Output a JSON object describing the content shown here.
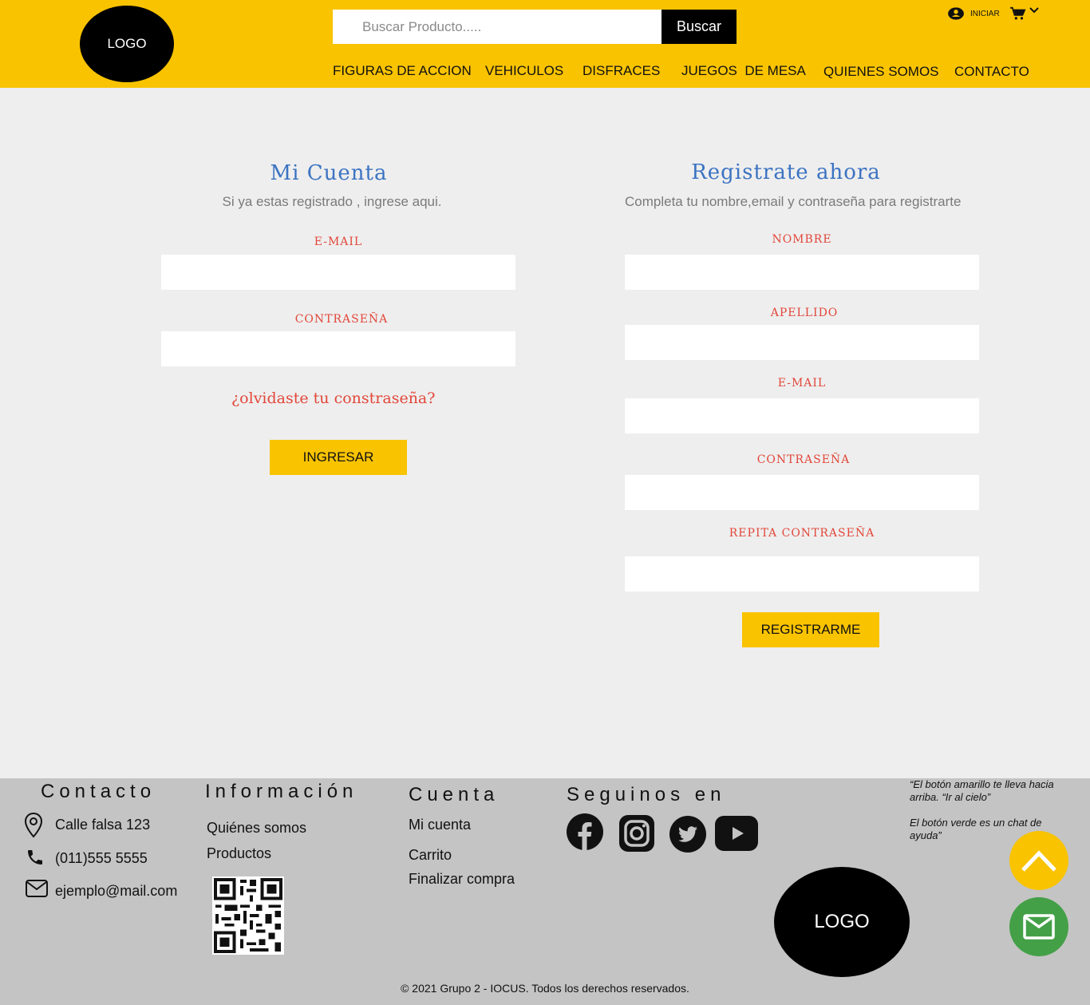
{
  "header": {
    "logo_text": "LOGO",
    "search": {
      "placeholder": "Buscar Producto.....",
      "button_label": "Buscar"
    },
    "login_label": "INICIAR",
    "nav": [
      {
        "label": "FIGURAS DE ACCION"
      },
      {
        "label": "VEHICULOS"
      },
      {
        "label": "DISFRACES"
      },
      {
        "label": "JUEGOS  DE MESA"
      },
      {
        "label": "QUIENES SOMOS"
      },
      {
        "label": "CONTACTO"
      }
    ]
  },
  "login": {
    "title": "Mi Cuenta",
    "subtitle": "Si ya estas registrado , ingrese aqui.",
    "email_label": "E-MAIL",
    "password_label": "CONTRASEÑA",
    "forgot_label": "¿olvidaste tu constraseña?",
    "submit_label": "INGRESAR"
  },
  "register": {
    "title": "Registrate ahora",
    "subtitle": "Completa tu nombre,email y contraseña para registrarte",
    "name_label": "NOMBRE",
    "lastname_label": "APELLIDO",
    "email_label": "E-MAIL",
    "password_label": "CONTRASEÑA",
    "repeat_password_label": "REPITA CONTRASEÑA",
    "submit_label": "REGISTRARME"
  },
  "footer": {
    "contact": {
      "heading": "Contacto",
      "address": "Calle falsa 123",
      "phone": "(011)555 5555",
      "email": "ejemplo@mail.com"
    },
    "info": {
      "heading": "Información",
      "links": [
        "Quiénes somos",
        "Productos"
      ]
    },
    "account": {
      "heading": "Cuenta",
      "links": [
        "Mi cuenta",
        "Carrito",
        "Finalizar compra"
      ]
    },
    "social": {
      "heading": "Seguinos en",
      "icons": [
        "facebook-icon",
        "instagram-icon",
        "twitter-icon",
        "youtube-icon"
      ]
    },
    "logo_text": "LOGO",
    "note_line1": "“El botón amarillo te lleva hacia arriba. “Ir al cielo”",
    "note_line2": "El botón verde es un chat de ayuda”",
    "copyright": "© 2021 Grupo 2 - IOCUS. Todos los derechos reservados."
  },
  "colors": {
    "header_bg": "#f9c300",
    "page_bg": "#eeeeee",
    "footer_bg": "#c4c4c4",
    "accent_yellow": "#f9c300",
    "chat_green": "#43a047",
    "title_blue": "#3b73c2",
    "label_red": "#e2473a"
  }
}
